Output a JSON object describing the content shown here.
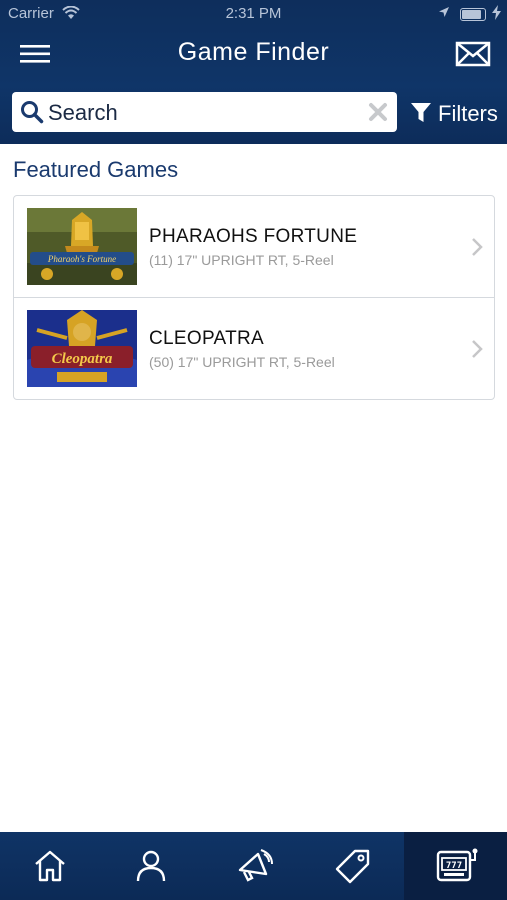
{
  "status_bar": {
    "carrier": "Carrier",
    "time": "2:31 PM"
  },
  "header": {
    "title": "Game Finder"
  },
  "search": {
    "placeholder": "Search"
  },
  "filters": {
    "label": "Filters"
  },
  "section": {
    "title": "Featured Games"
  },
  "games": [
    {
      "name": "PHARAOHS FORTUNE",
      "details": "(11) 17\" UPRIGHT RT, 5-Reel",
      "thumb_label": "Pharaoh's Fortune"
    },
    {
      "name": "CLEOPATRA",
      "details": "(50) 17\" UPRIGHT RT, 5-Reel",
      "thumb_label": "Cleopatra"
    }
  ],
  "tab_bar": {
    "tabs": [
      {
        "icon": "home-icon"
      },
      {
        "icon": "profile-icon"
      },
      {
        "icon": "megaphone-icon"
      },
      {
        "icon": "tag-icon"
      },
      {
        "icon": "slot-machine-icon",
        "active": true
      }
    ]
  },
  "colors": {
    "nav_bg": "#0f3568",
    "accent_text": "#1a3a6e",
    "divider": "#d5d9de"
  }
}
